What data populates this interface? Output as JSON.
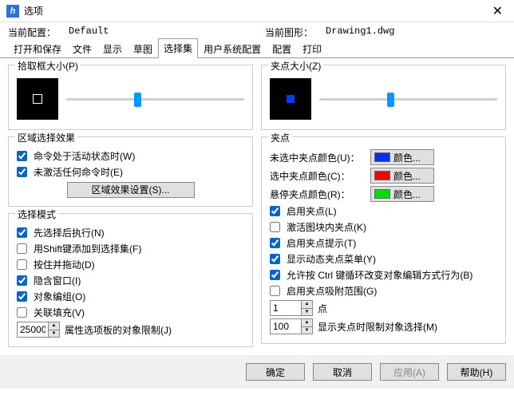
{
  "window": {
    "title": "选项"
  },
  "info": {
    "config_label": "当前配置：",
    "config_value": "Default",
    "drawing_label": "当前图形：",
    "drawing_value": "Drawing1.dwg"
  },
  "tabs": {
    "open_save": "打开和保存",
    "file": "文件",
    "display": "显示",
    "drafting": "草图",
    "selection": "选择集",
    "user": "用户系统配置",
    "profile": "配置",
    "plot": "打印"
  },
  "left": {
    "pickbox": {
      "legend": "拾取框大小(P)"
    },
    "region": {
      "legend": "区域选择效果",
      "active_cmd": "命令处于活动状态时(W)",
      "no_cmd": "未激活任何命令时(E)",
      "settings_btn": "区域效果设置(S)..."
    },
    "modes": {
      "legend": "选择模式",
      "items": [
        {
          "label": "先选择后执行(N)",
          "checked": true
        },
        {
          "label": "用Shift键添加到选择集(F)",
          "checked": false
        },
        {
          "label": "按住并拖动(D)",
          "checked": false
        },
        {
          "label": "隐含窗口(I)",
          "checked": true
        },
        {
          "label": "对象编组(O)",
          "checked": true
        },
        {
          "label": "关联填充(V)",
          "checked": false
        }
      ],
      "limit_value": "25000",
      "limit_label": "属性选项板的对象限制(J)"
    }
  },
  "right": {
    "gripsize": {
      "legend": "夹点大小(Z)"
    },
    "grips": {
      "legend": "夹点",
      "colors": [
        {
          "label": "未选中夹点颜色(U)：",
          "btn": "颜色...",
          "swatch": "#002eff"
        },
        {
          "label": "选中夹点颜色(C)：",
          "btn": "颜色...",
          "swatch": "#ff0000"
        },
        {
          "label": "悬停夹点颜色(R)：",
          "btn": "颜色...",
          "swatch": "#00e000"
        }
      ],
      "checks": [
        {
          "label": "启用夹点(L)",
          "checked": true
        },
        {
          "label": "激活图块内夹点(K)",
          "checked": false
        },
        {
          "label": "启用夹点提示(T)",
          "checked": true
        },
        {
          "label": "显示动态夹点菜单(Y)",
          "checked": true
        },
        {
          "label": "允许按 Ctrl 键循环改变对象编辑方式行为(B)",
          "checked": true
        },
        {
          "label": "启用夹点吸附范围(G)",
          "checked": false
        }
      ],
      "point_value": "1",
      "point_label": "点",
      "limit_value": "100",
      "limit_label": "显示夹点时限制对象选择(M)"
    }
  },
  "buttons": {
    "ok": "确定",
    "cancel": "取消",
    "apply": "应用(A)",
    "help": "帮助(H)"
  }
}
